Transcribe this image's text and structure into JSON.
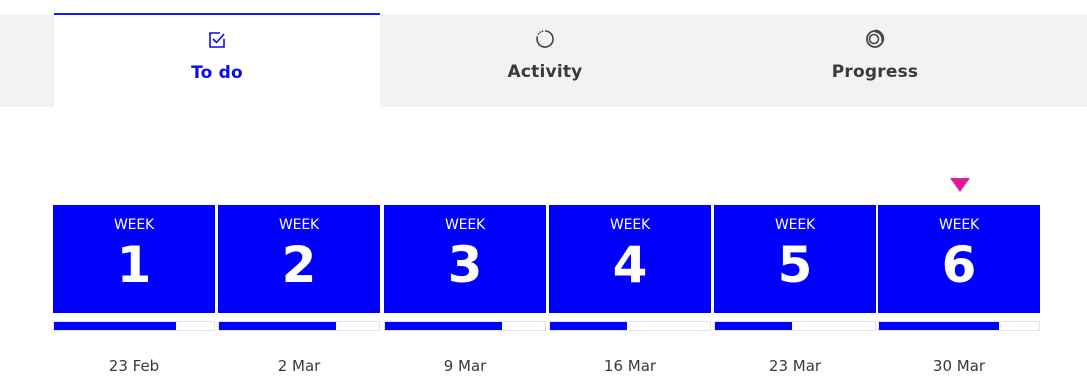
{
  "tabs": [
    {
      "label": "To do",
      "icon": "checkbox-icon",
      "active": true
    },
    {
      "label": "Activity",
      "icon": "activity-ring-icon",
      "active": false
    },
    {
      "label": "Progress",
      "icon": "progress-ring-icon",
      "active": false
    }
  ],
  "weeks": [
    {
      "word": "WEEK",
      "number": "1",
      "date": "23 Feb",
      "progress": 0.76
    },
    {
      "word": "WEEK",
      "number": "2",
      "date": "2 Mar",
      "progress": 0.73
    },
    {
      "word": "WEEK",
      "number": "3",
      "date": "9 Mar",
      "progress": 0.73
    },
    {
      "word": "WEEK",
      "number": "4",
      "date": "16 Mar",
      "progress": 0.48
    },
    {
      "word": "WEEK",
      "number": "5",
      "date": "23 Mar",
      "progress": 0.48
    },
    {
      "word": "WEEK",
      "number": "6",
      "date": "30 Mar",
      "progress": 0.75
    }
  ],
  "current_week_index": 5,
  "colors": {
    "accent": "#0000ff",
    "marker": "#e0189b",
    "tab_bar": "#f2f2f2"
  }
}
